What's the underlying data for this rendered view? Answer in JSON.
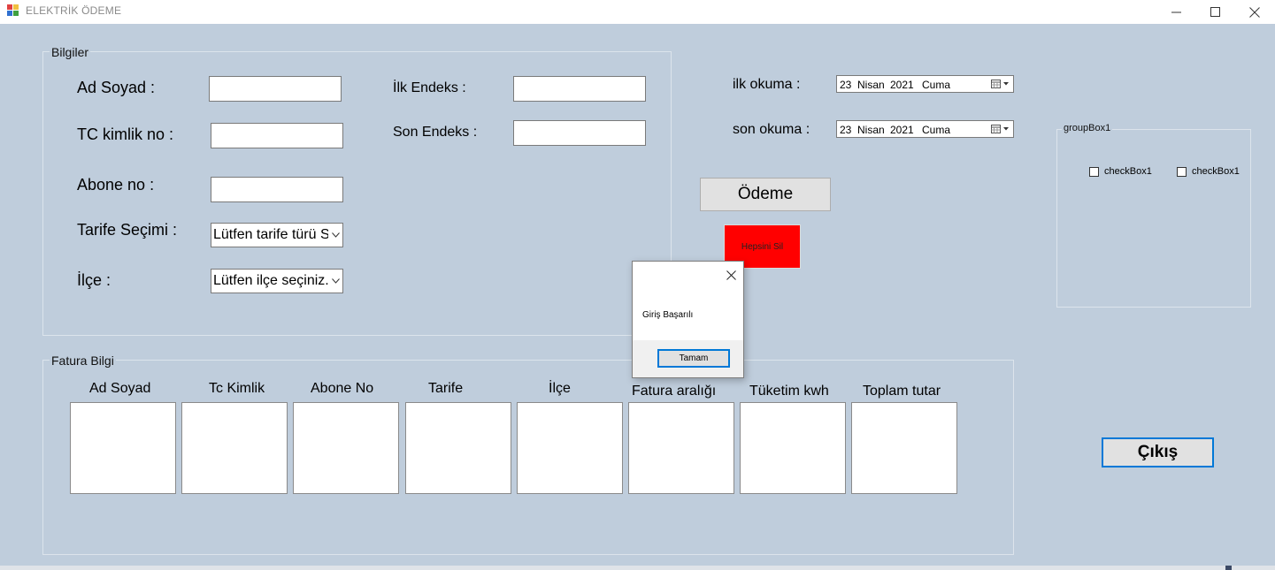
{
  "window": {
    "title": "ELEKTRİK ÖDEME",
    "controls": {
      "minimize": "—",
      "maximize": "☐",
      "close": "✕"
    }
  },
  "bilgiler": {
    "legend": "Bilgiler",
    "ad_soyad_label": "Ad Soyad :",
    "ad_soyad_value": "",
    "tc_label": "TC kimlik no :",
    "tc_value": "",
    "abone_label": "Abone no :",
    "abone_value": "",
    "tarife_label": "Tarife Seçimi :",
    "tarife_selected": "Lütfen tarife türü Seçiniz",
    "ilce_label": "İlçe :",
    "ilce_selected": "Lütfen ilçe seçiniz.",
    "ilk_endeks_label": "İlk Endeks :",
    "ilk_endeks_value": "",
    "son_endeks_label": "Son Endeks :",
    "son_endeks_value": ""
  },
  "okuma": {
    "ilk_label": "ilk okuma :",
    "son_label": "son okuma :",
    "ilk_date": {
      "day": "23",
      "month": "Nisan",
      "year": "2021",
      "weekday": "Cuma"
    },
    "son_date": {
      "day": "23",
      "month": "Nisan",
      "year": "2021",
      "weekday": "Cuma"
    }
  },
  "buttons": {
    "odeme": "Ödeme",
    "hepsini_sil": "Hepsini Sil",
    "cikis": "Çıkış"
  },
  "groupbox1": {
    "legend": "groupBox1",
    "checkbox_a": "checkBox1",
    "checkbox_b": "checkBox1"
  },
  "fatura": {
    "legend": "Fatura Bilgi",
    "columns": [
      "Ad Soyad",
      "Tc Kimlik",
      "Abone No",
      "Tarife",
      "İlçe",
      "Fatura aralığı",
      "Tüketim kwh",
      "Toplam tutar"
    ]
  },
  "messagebox": {
    "message": "Giriş Başarılı",
    "ok_label": "Tamam",
    "close": "✕"
  },
  "colors": {
    "background": "#bfcddc",
    "hepsini_sil_bg": "#ff0000",
    "focus_border": "#0078d7"
  }
}
